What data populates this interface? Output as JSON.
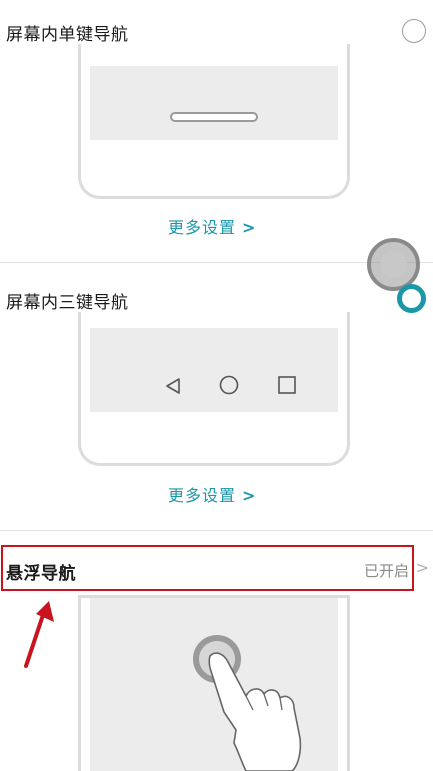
{
  "sections": {
    "single_key": {
      "title": "屏幕内单键导航",
      "more_label": "更多设置",
      "selected": false
    },
    "three_key": {
      "title": "屏幕内三键导航",
      "more_label": "更多设置",
      "selected": true
    },
    "floating": {
      "title": "悬浮导航",
      "status": "已开启"
    }
  },
  "icons": {
    "more_chevron": "chevron-right-icon",
    "status_chevron": "chevron-right-icon",
    "nav_back": "triangle-back-icon",
    "nav_home": "circle-home-icon",
    "nav_recent": "square-recent-icon",
    "float_ball": "floating-ball-icon",
    "hand": "tap-hand-icon",
    "arrow": "annotation-arrow-icon"
  },
  "colors": {
    "accent": "#1a97a9",
    "annotation": "#c8141e",
    "screen": "#ececec",
    "phone_border": "#dcdcdc"
  }
}
